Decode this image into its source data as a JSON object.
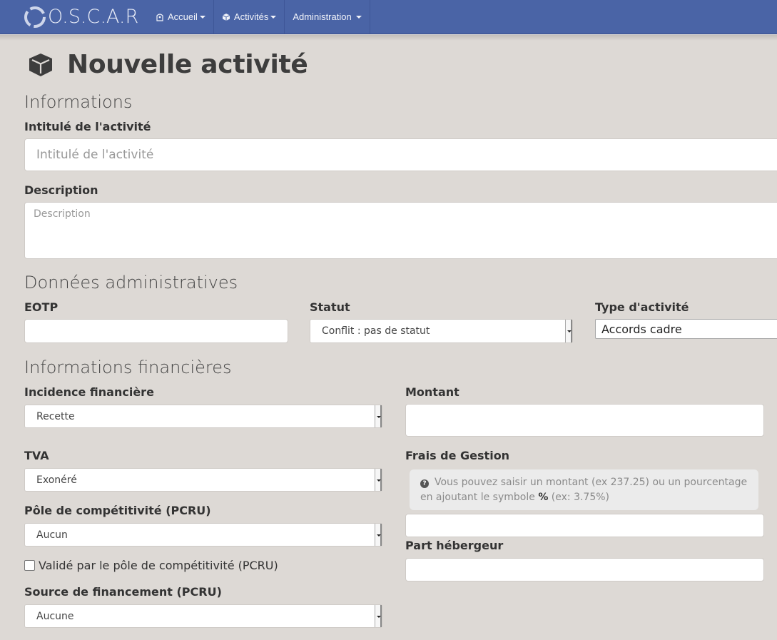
{
  "navbar": {
    "brand": "O.S.C.A.R",
    "menu": [
      {
        "label": "Accueil",
        "icon": "home-icon"
      },
      {
        "label": "Activités",
        "icon": "cube-icon"
      },
      {
        "label": "Administration",
        "icon": ""
      }
    ]
  },
  "page": {
    "title": "Nouvelle activité",
    "title_icon": "cube-icon"
  },
  "sections": {
    "informations": "Informations",
    "admin": "Données administratives",
    "finance": "Informations financières"
  },
  "form": {
    "intitule": {
      "label": "Intitulé de l'activité",
      "placeholder": "Intitulé de l'activité",
      "value": ""
    },
    "description": {
      "label": "Description",
      "placeholder": "Description",
      "value": ""
    },
    "eotp": {
      "label": "EOTP",
      "value": ""
    },
    "statut": {
      "label": "Statut",
      "value": "Conflit : pas de statut"
    },
    "type_activite": {
      "label": "Type d'activité",
      "value": "Accords cadre"
    },
    "incidence": {
      "label": "Incidence financière",
      "value": "Recette"
    },
    "montant": {
      "label": "Montant",
      "value": ""
    },
    "tva": {
      "label": "TVA",
      "value": "Exonéré"
    },
    "frais_gestion": {
      "label": "Frais de Gestion",
      "help_text_1": "Vous pouvez saisir un montant (ex 237.25) ou un pourcentage en ajoutant le symbole",
      "help_symbol": "%",
      "help_text_2": "(ex: 3.75%)",
      "value": ""
    },
    "pole": {
      "label": "Pôle de compétitivité (PCRU)",
      "value": "Aucun"
    },
    "part_hebergeur": {
      "label": "Part hébergeur",
      "value": ""
    },
    "valide_pole": {
      "label": "Validé par le pôle de compétitivité (PCRU)",
      "checked": false
    },
    "source": {
      "label": "Source de financement (PCRU)",
      "value": "Aucune"
    }
  }
}
